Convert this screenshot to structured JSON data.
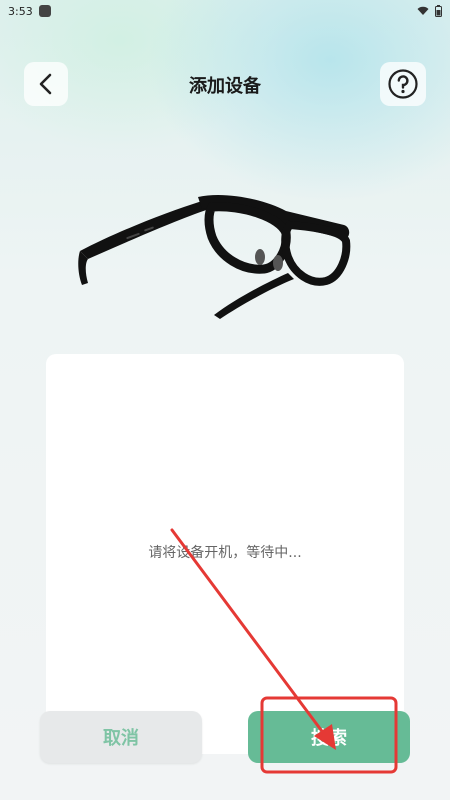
{
  "status_bar": {
    "time": "3:53"
  },
  "header": {
    "title": "添加设备"
  },
  "card": {
    "waiting_text": "请将设备开机，等待中..."
  },
  "actions": {
    "cancel_label": "取消",
    "search_label": "搜索"
  },
  "colors": {
    "primary": "#66bb96",
    "cancel_text": "#7fc4a5",
    "annotation": "#e53935"
  },
  "icons": {
    "back": "chevron-left-icon",
    "help": "question-circle-icon",
    "wifi": "wifi-icon",
    "battery": "battery-icon"
  }
}
